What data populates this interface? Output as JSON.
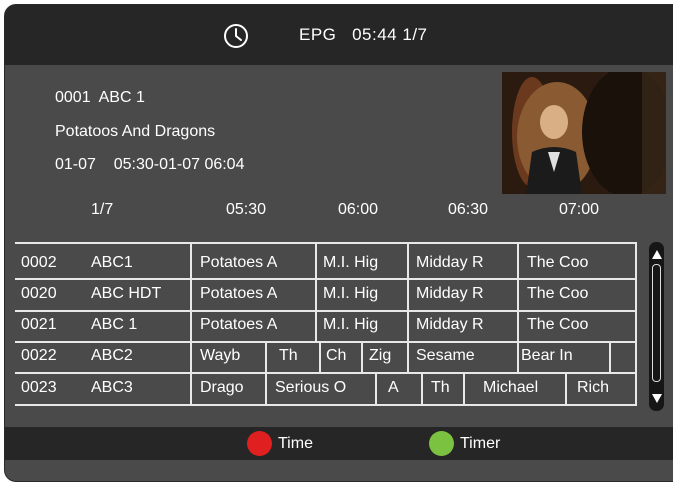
{
  "header": {
    "title": "EPG",
    "time": "05:44",
    "page": "1/7"
  },
  "current": {
    "channel_line": "0001  ABC 1",
    "program": "Potatoos And Dragons",
    "schedule": "01-07    05:30-01-07 06:04"
  },
  "timeline": {
    "page": "1/7",
    "times": [
      "05:30",
      "06:00",
      "06:30",
      "07:00"
    ]
  },
  "rows": [
    {
      "num": "0002",
      "name": "ABC1",
      "programs": [
        "Potatoes A",
        "M.I. Hig",
        "Midday R",
        "The Coo"
      ]
    },
    {
      "num": "0020",
      "name": "ABC HDT",
      "programs": [
        "Potatoes A",
        "M.I. Hig",
        "Midday R",
        "The Coo"
      ]
    },
    {
      "num": "0021",
      "name": "ABC 1",
      "programs": [
        "Potatoes A",
        "M.I. Hig",
        "Midday R",
        "The Coo"
      ]
    },
    {
      "num": "0022",
      "name": "ABC2",
      "programs": [
        "Wayb",
        "Th",
        "Ch",
        "Zig",
        "Sesame",
        "Bear In"
      ]
    },
    {
      "num": "0023",
      "name": "ABC3",
      "programs": [
        "Drago",
        "Serious O",
        "A",
        "Th",
        "Michael",
        "Rich"
      ]
    }
  ],
  "footer": {
    "red_label": "Time",
    "green_label": "Timer",
    "red_color": "#e02020",
    "green_color": "#7cc241"
  },
  "icons": {
    "clock": "clock-icon",
    "scroll_up": "arrow-up-icon",
    "scroll_down": "arrow-down-icon"
  }
}
